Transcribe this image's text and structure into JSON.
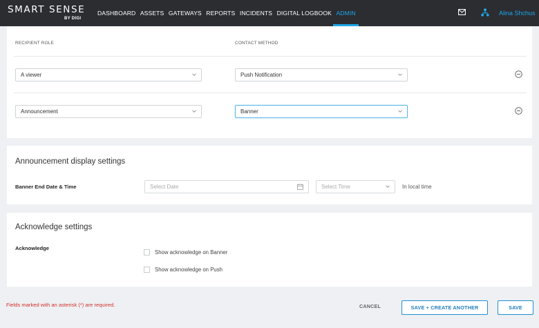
{
  "header": {
    "logo_main": "SMART SENSE",
    "logo_sub": "BY DIGI",
    "nav": [
      "DASHBOARD",
      "ASSETS",
      "GATEWAYS",
      "REPORTS",
      "INCIDENTS",
      "DIGITAL LOGBOOK",
      "ADMIN"
    ],
    "active_nav": "ADMIN",
    "user_name": "Alina Shchus",
    "icons": [
      "mail-icon",
      "org-chart-icon"
    ]
  },
  "recipients": {
    "col_role": "RECIPIENT ROLE",
    "col_method": "CONTACT METHOD",
    "rows": [
      {
        "role": "A viewer",
        "method": "Push Notification"
      },
      {
        "role": "Announcement",
        "method": "Banner"
      }
    ]
  },
  "display_settings": {
    "title": "Announcement display settings",
    "label": "Banner End Date & Time",
    "date_placeholder": "Select Date",
    "time_placeholder": "Select Time",
    "suffix": "In local time"
  },
  "acknowledge": {
    "title": "Acknowledge settings",
    "label": "Acknowledge",
    "options": [
      {
        "label": "Show acknowledge on Banner",
        "checked": false
      },
      {
        "label": "Show acknowledge on Push",
        "checked": false
      }
    ]
  },
  "footer": {
    "required_note": "Fields marked with an asterisk (*) are required.",
    "cancel": "CANCEL",
    "save_another": "SAVE + CREATE ANOTHER",
    "save": "SAVE"
  },
  "colors": {
    "accent": "#1fa6e8",
    "topbar": "#2b2d31",
    "error": "#d0312d"
  }
}
